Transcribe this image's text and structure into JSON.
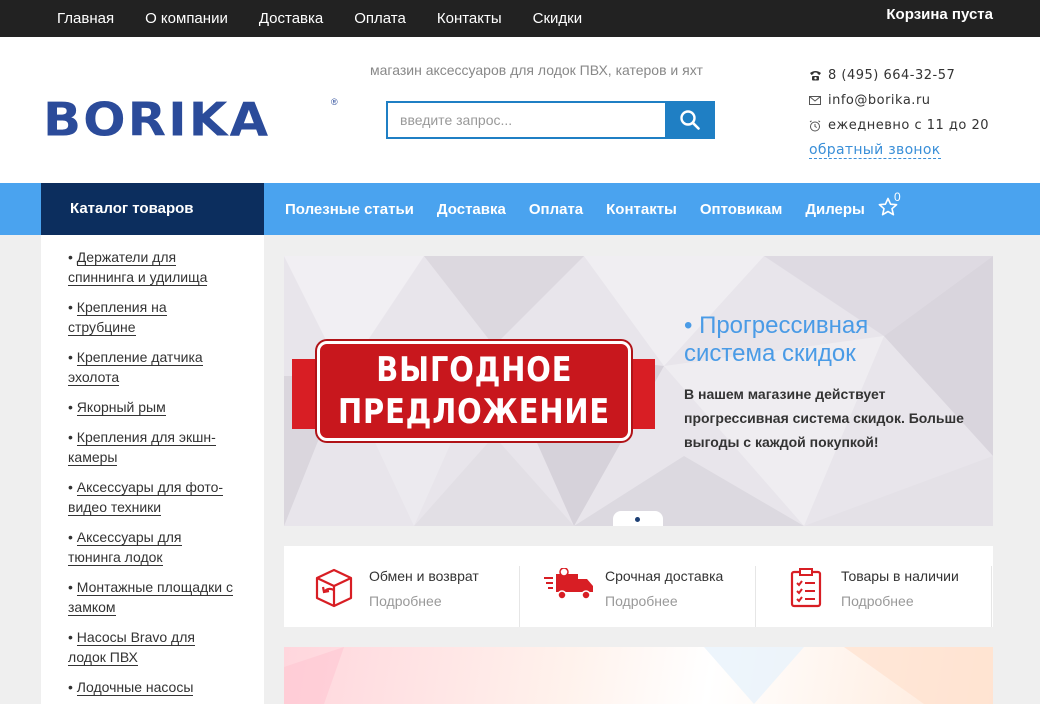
{
  "topbar": {
    "nav": [
      "Главная",
      "О компании",
      "Доставка",
      "Оплата",
      "Контакты",
      "Скидки"
    ],
    "cart": "Корзина пуста"
  },
  "header": {
    "logo": "BORIKA",
    "logo_mark": "®",
    "tagline": "магазин аксессуаров для лодок ПВХ, катеров и яхт",
    "search": {
      "placeholder": "введите запрос...",
      "value": ""
    },
    "phone": "8 (495) 664-32-57",
    "email": "info@borika.ru",
    "hours": "ежедневно с 11 до 20",
    "callback": "обратный звонок"
  },
  "mainnav": {
    "catalog": "Каталог товаров",
    "links": [
      "Полезные статьи",
      "Доставка",
      "Оплата",
      "Контакты",
      "Оптовикам",
      "Дилеры"
    ],
    "favorites_count": "0"
  },
  "sidebar": {
    "items": [
      {
        "l1": "Держатели для",
        "l2": "спиннинга и удилища"
      },
      {
        "l1": "Крепления на",
        "l2": "струбцине"
      },
      {
        "l1": "Крепление датчика",
        "l2": "эхолота"
      },
      {
        "l1": "Якорный рым",
        "l2": ""
      },
      {
        "l1": "Крепления для экшн-",
        "l2": "камеры"
      },
      {
        "l1": "Аксессуары для фото-",
        "l2": "видео техники"
      },
      {
        "l1": "Аксессуары для",
        "l2": "тюнинга лодок"
      },
      {
        "l1": "Монтажные площадки с",
        "l2": "замком"
      },
      {
        "l1": "Насосы Bravo для",
        "l2": "лодок ПВХ"
      },
      {
        "l1": "Лодочные насосы",
        "l2": ""
      }
    ]
  },
  "banner": {
    "promo_line1": "ВЫГОДНОЕ",
    "promo_line2": "ПРЕДЛОЖЕНИЕ",
    "title": "• Прогрессивная система скидок",
    "text": "В нашем магазине действует прогрессивная система скидок. Больше выгоды с каждой покупкой!"
  },
  "features": [
    {
      "title": "Обмен и возврат",
      "more": "Подробнее",
      "icon": "return-box-icon"
    },
    {
      "title": "Срочная доставка",
      "more": "Подробнее",
      "icon": "delivery-truck-icon"
    },
    {
      "title": "Товары в наличии",
      "more": "Подробнее",
      "icon": "checklist-icon"
    }
  ],
  "colors": {
    "topbar": "#222222",
    "brand_blue": "#2b4b9a",
    "nav_blue": "#4aa3ef",
    "catalog_dark": "#0c2e5e",
    "accent_red": "#d81e24",
    "link_blue": "#3a8fd8"
  }
}
